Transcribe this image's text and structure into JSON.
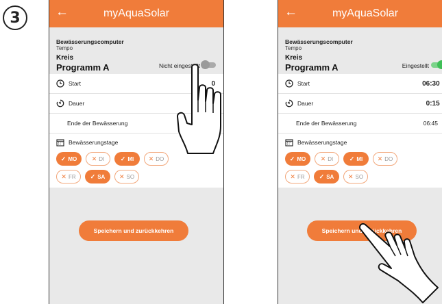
{
  "step_number": "3",
  "accent": "#f07c3a",
  "screens": [
    {
      "app_title": "myAquaSolar",
      "device_label": "Bewässerungscomputer",
      "device_name": "Tempo",
      "circuit_label": "Kreis",
      "program_name": "Programm A",
      "status_text": "Nicht eingestellt",
      "toggle_on": false,
      "rows": {
        "start_label": "Start",
        "start_value": "0",
        "duration_label": "Dauer",
        "end_label": "Ende der Bewässerung"
      },
      "days_title": "Bewässerungstage",
      "days": [
        {
          "label": "MO",
          "selected": true
        },
        {
          "label": "DI",
          "selected": false
        },
        {
          "label": "MI",
          "selected": true
        },
        {
          "label": "DO",
          "selected": false
        },
        {
          "label": "FR",
          "selected": false
        },
        {
          "label": "SA",
          "selected": true
        },
        {
          "label": "SO",
          "selected": false
        }
      ],
      "save_button": "Speichern und zurückkehren"
    },
    {
      "app_title": "myAquaSolar",
      "device_label": "Bewässerungscomputer",
      "device_name": "Tempo",
      "circuit_label": "Kreis",
      "program_name": "Programm A",
      "status_text": "Eingestellt",
      "toggle_on": true,
      "rows": {
        "start_label": "Start",
        "start_value": "06:30",
        "duration_label": "Dauer",
        "duration_value": "0:15",
        "end_label": "Ende der Bewässerung",
        "end_value": "06:45"
      },
      "days_title": "Bewässerungstage",
      "days": [
        {
          "label": "MO",
          "selected": true
        },
        {
          "label": "DI",
          "selected": false
        },
        {
          "label": "MI",
          "selected": true
        },
        {
          "label": "DO",
          "selected": false
        },
        {
          "label": "FR",
          "selected": false
        },
        {
          "label": "SA",
          "selected": true
        },
        {
          "label": "SO",
          "selected": false
        }
      ],
      "save_button": "Speichern und zurückkehren"
    }
  ]
}
